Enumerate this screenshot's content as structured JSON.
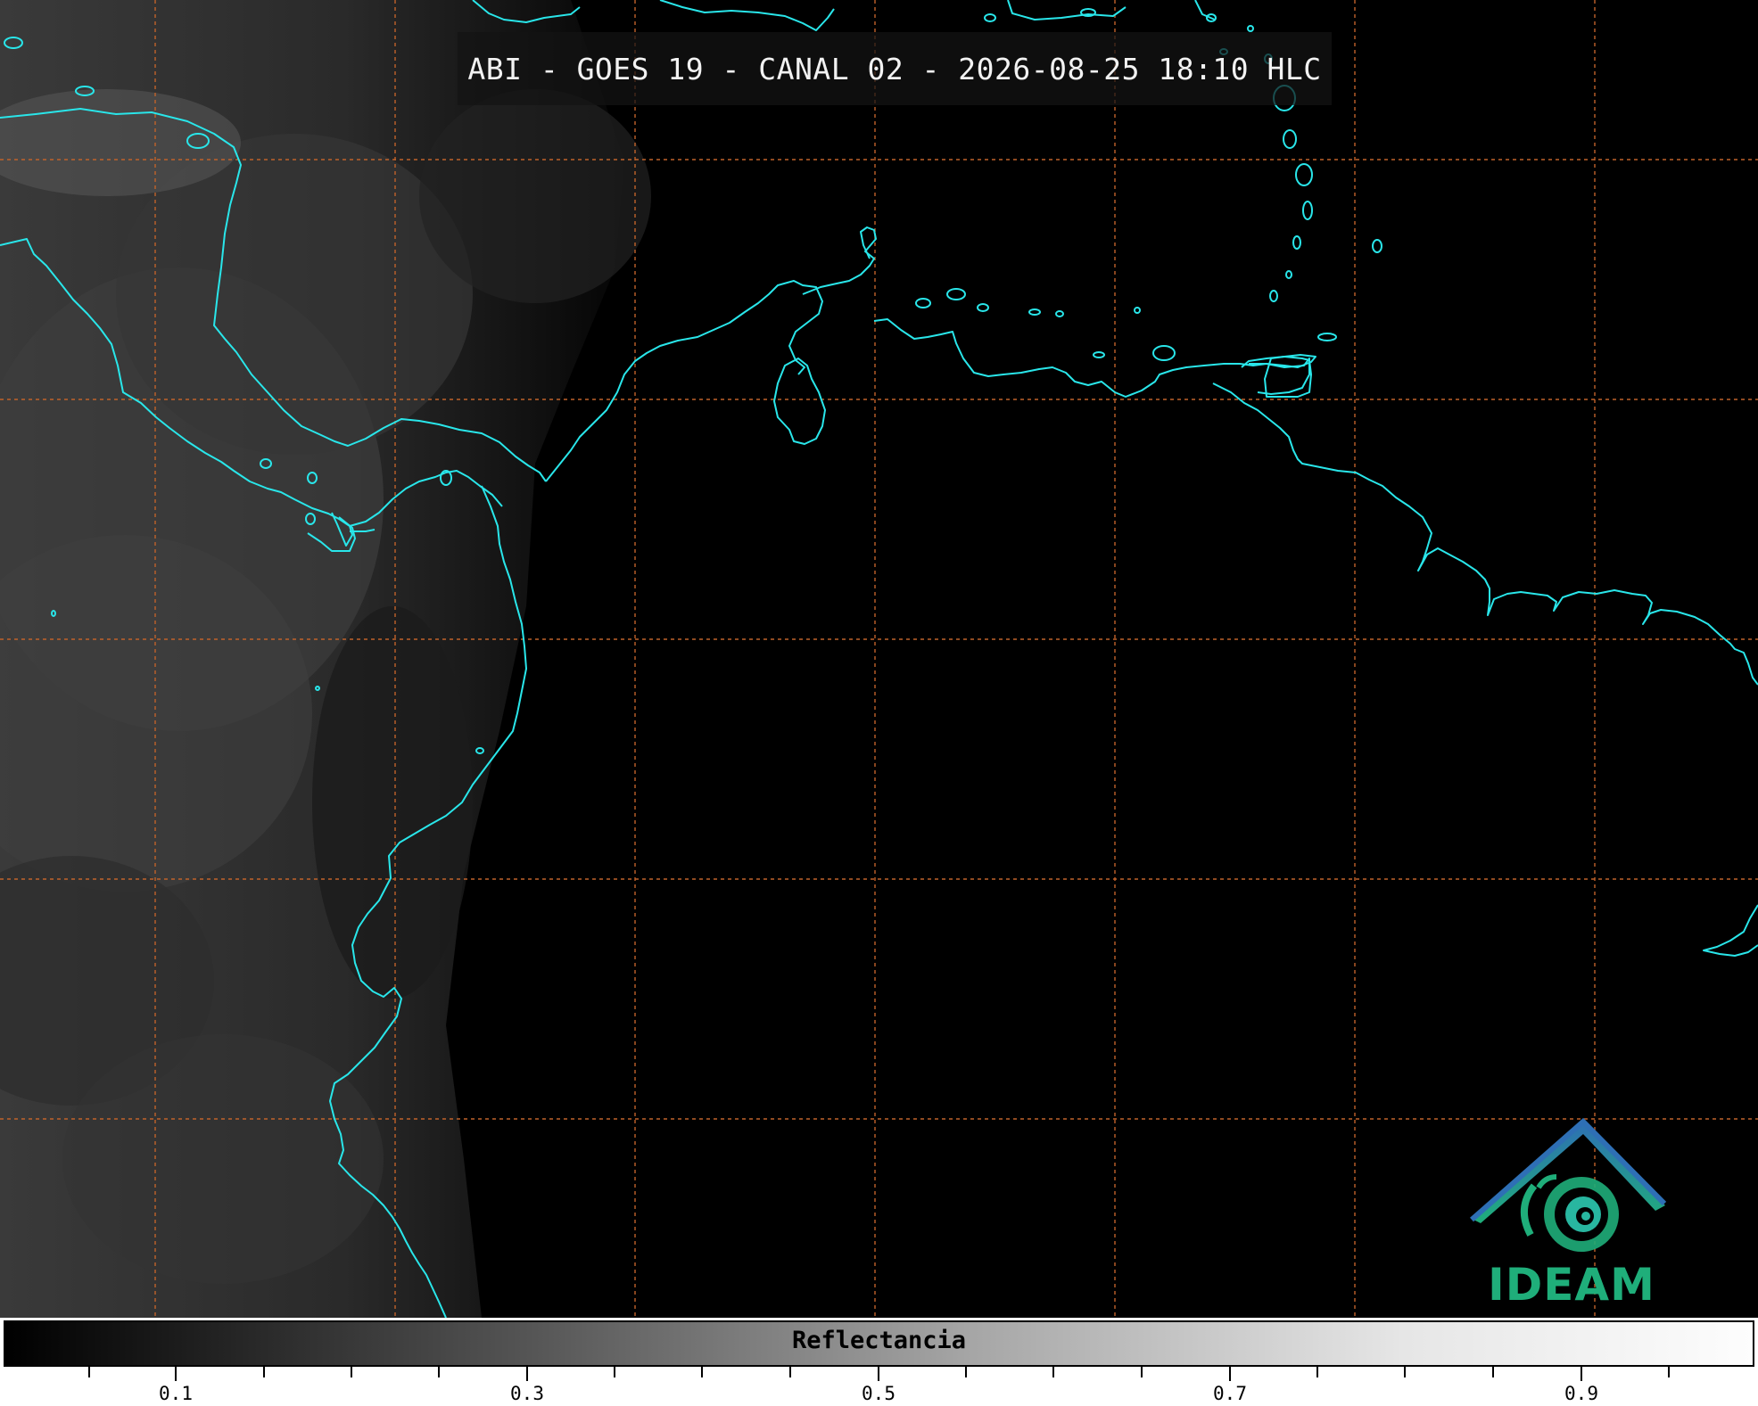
{
  "title": "ABI - GOES 19 - CANAL 02 - 2026-08-25 18:10 HLC",
  "logo": {
    "name": "IDEAM"
  },
  "colorbar": {
    "label": "Reflectancia",
    "tick_labels": [
      "0.1",
      "0.3",
      "0.5",
      "0.7",
      "0.9"
    ]
  },
  "colors": {
    "coastline": "#29e6ea",
    "gridline": "#c0622a",
    "logo_blue": "#2e6fb5",
    "logo_green": "#1fae7a"
  }
}
